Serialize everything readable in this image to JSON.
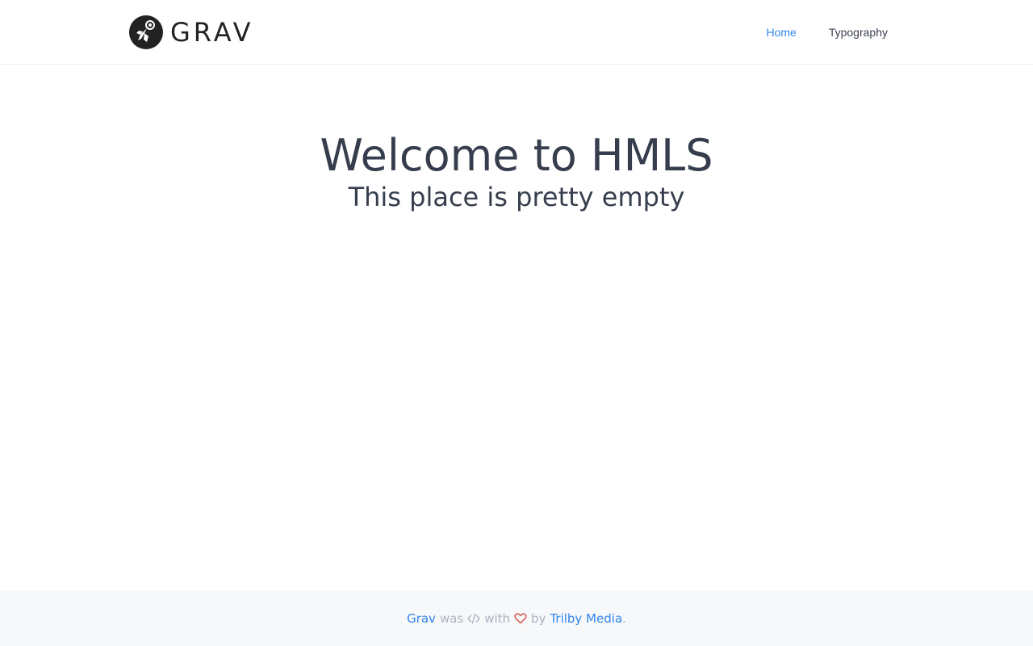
{
  "header": {
    "logo_text": "GRAV",
    "logo_icon": "astronaut-icon",
    "nav": [
      {
        "label": "Home",
        "active": true
      },
      {
        "label": "Typography",
        "active": false
      }
    ]
  },
  "hero": {
    "title": "Welcome to HMLS",
    "subtitle": "This place is pretty empty"
  },
  "footer": {
    "grav_link": "Grav",
    "was": "was",
    "code_icon": "code-icon",
    "with": "with",
    "heart_icon": "heart-icon",
    "by": "by",
    "trilby_link": "Trilby Media",
    "period": "."
  },
  "colors": {
    "accent": "#3085ee",
    "text": "#363d4d",
    "muted": "#acb3c2",
    "heart": "#d9534f",
    "footer_bg": "#f7f8f9"
  }
}
